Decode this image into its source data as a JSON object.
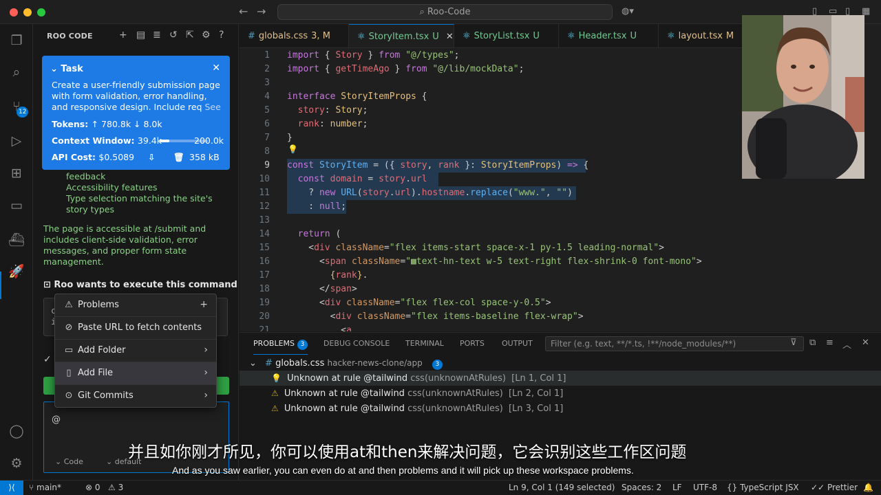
{
  "titlebar": {
    "search": "Roo-Code",
    "back": "←",
    "forward": "→"
  },
  "sidebar": {
    "title": "ROO CODE",
    "task": {
      "header": "Task",
      "description": "Create a user-friendly submission page with form validation, error handling, and responsive design. Include req",
      "see_more": "See more",
      "tokens_label": "Tokens:",
      "tokens_value": "↑ 780.8k  ↓ 8.0k",
      "context_label": "Context Window:",
      "context_used": "39.4k",
      "context_max": "200.0k",
      "context_fraction": 0.2,
      "cost_label": "API Cost:",
      "cost_value": "$0.5089",
      "size": "358 kB"
    },
    "list_items": [
      "feedback",
      "Accessibility features",
      "Type selection matching the site's",
      "story types"
    ],
    "paragraph": "The page is accessible at /submit and includes client-side validation, error messages, and proper form state management.",
    "command_label": "Roo wants to execute this command:",
    "command_text_1": "c",
    "command_text_2": "i",
    "chat_value": "@",
    "mode_1": "Code",
    "mode_2": "default"
  },
  "popup": {
    "items": [
      {
        "icon": "⚠",
        "label": "Problems",
        "right": "+"
      },
      {
        "icon": "⊘",
        "label": "Paste URL to fetch contents",
        "right": ""
      },
      {
        "icon": "▭",
        "label": "Add Folder",
        "right": "›"
      },
      {
        "icon": "▯",
        "label": "Add File",
        "right": "›"
      },
      {
        "icon": "⊙",
        "label": "Git Commits",
        "right": "›"
      }
    ]
  },
  "tabs": [
    {
      "name": "globals.css",
      "status": "3, M"
    },
    {
      "name": "StoryItem.tsx",
      "status": "U"
    },
    {
      "name": "StoryList.tsx",
      "status": "U"
    },
    {
      "name": "Header.tsx",
      "status": "U"
    },
    {
      "name": "layout.tsx",
      "status": "M"
    }
  ],
  "editor": {
    "line_numbers": [
      "1",
      "2",
      "3",
      "4",
      "5",
      "6",
      "7",
      "8",
      "9",
      "10",
      "11",
      "12",
      "13",
      "14",
      "15",
      "16",
      "17",
      "18",
      "19",
      "20",
      "21"
    ]
  },
  "panel": {
    "tabs": [
      "PROBLEMS",
      "DEBUG CONSOLE",
      "TERMINAL",
      "PORTS",
      "OUTPUT"
    ],
    "problems_count": "3",
    "filter_placeholder": "Filter (e.g. text, **/*.ts, !**/node_modules/**)",
    "group_file": "globals.css",
    "group_path": "hacker-news-clone/app",
    "group_count": "3",
    "problems": [
      {
        "message": "Unknown at rule @tailwind",
        "source": "css(unknownAtRules)",
        "loc": "[Ln 1, Col 1]"
      },
      {
        "message": "Unknown at rule @tailwind",
        "source": "css(unknownAtRules)",
        "loc": "[Ln 2, Col 1]"
      },
      {
        "message": "Unknown at rule @tailwind",
        "source": "css(unknownAtRules)",
        "loc": "[Ln 3, Col 1]"
      }
    ]
  },
  "subtitles": {
    "zh": "并且如你刚才所见，你可以使用at和then来解决问题，它会识别这些工作区问题",
    "en": "And as you saw earlier, you can even do at and then problems and it will pick up these workspace problems."
  },
  "statusbar": {
    "branch": "main*",
    "errors": "⊗ 0",
    "warnings": "⚠ 3",
    "position": "Ln 9, Col 1 (149 selected)",
    "spaces": "Spaces: 2",
    "eol": "LF",
    "encoding": "UTF-8",
    "language": "TypeScript JSX",
    "formatter": "Prettier"
  }
}
